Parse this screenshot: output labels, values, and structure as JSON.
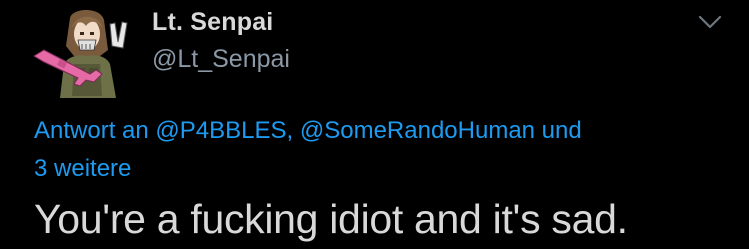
{
  "user": {
    "display_name": "Lt. Senpai",
    "handle": "@Lt_Senpai",
    "avatar_icon": "anime-soldier-avatar-icon"
  },
  "menu": {
    "icon": "chevron-down-icon"
  },
  "reply": {
    "prefix": "Antwort an ",
    "mentions": [
      "@P4BBLES",
      "@SomeRandoHuman"
    ],
    "separator": ", ",
    "conjunction": " und ",
    "more": "3 weitere"
  },
  "tweet": {
    "text": "You're a fucking idiot and it's sad."
  },
  "colors": {
    "background": "#000000",
    "text": "#d9d9d9",
    "secondary": "#8b98a5",
    "link": "#1d9bf0"
  }
}
